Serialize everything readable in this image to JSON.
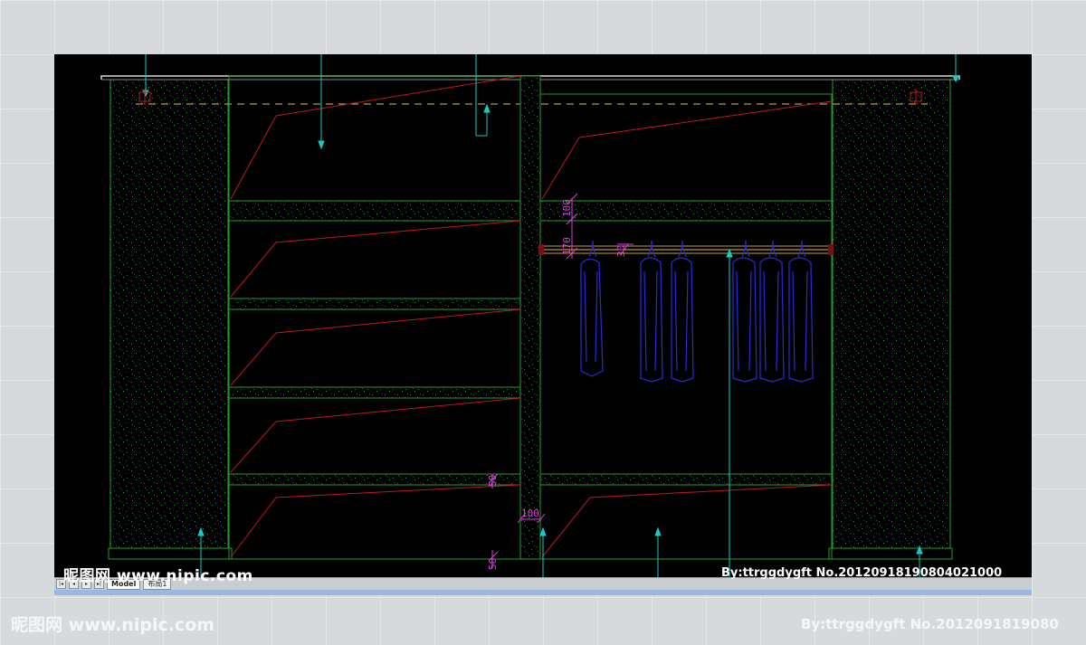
{
  "dimensions": {
    "d100_top": "100",
    "d170": "170",
    "d30": "30",
    "d50_a": "50",
    "d100_bottom": "100",
    "d50_b": "50"
  },
  "layout_tabs": {
    "model": "Model",
    "layout1": "布局1"
  },
  "watermark": {
    "site_cn": "昵图网",
    "site_url": "www.nipic.com",
    "credit": "By:ttrggdygft  No.20120918190804021000",
    "credit_cut": "By:ttrggdygft  No.2012091819080"
  },
  "colors": {
    "background": "#000000",
    "cabinet_lines": "#1f9e2a",
    "hatch": "#1c6b22",
    "diagonal": "#c0181b",
    "dimension": "#e040e0",
    "garment": "#2a2ad8",
    "leader": "#19c9c9",
    "top_line": "#d8d8d8",
    "dashed": "#d8c85a"
  },
  "icons": [
    "nav-first-icon",
    "nav-prev-icon",
    "nav-next-icon",
    "nav-last-icon"
  ]
}
